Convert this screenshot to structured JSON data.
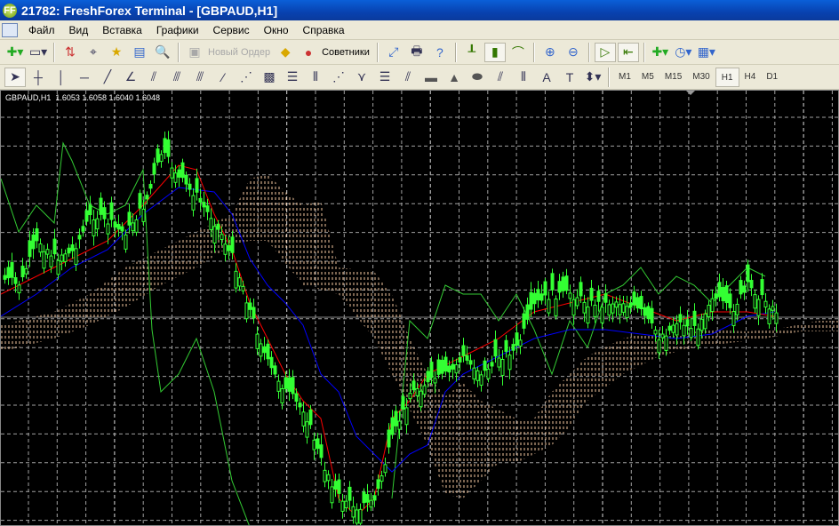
{
  "window": {
    "title": "21782: FreshForex Terminal - [GBPAUD,H1]",
    "app_icon": "FF"
  },
  "menu": [
    "Файл",
    "Вид",
    "Вставка",
    "Графики",
    "Сервис",
    "Окно",
    "Справка"
  ],
  "toolbar": {
    "new_order": "Новый Ордер",
    "experts": "Советники"
  },
  "drawing_tools": {
    "text_tool": "A",
    "text_label_tool": "T"
  },
  "timeframes": [
    "M1",
    "M5",
    "M15",
    "M30",
    "H1",
    "H4",
    "D1"
  ],
  "active_timeframe": "H1",
  "chart": {
    "symbol": "GBPAUD,H1",
    "open": "1.6053",
    "high": "1.6058",
    "low": "1.6040",
    "close": "1.6048",
    "colors": {
      "background": "#000000",
      "candles": "#33ff33",
      "tenkan": "#ff0000",
      "kijun": "#0000ff",
      "chikou": "#33cc33",
      "cloud": "#f5c7a0",
      "grid": "#a0a0a0"
    }
  }
}
